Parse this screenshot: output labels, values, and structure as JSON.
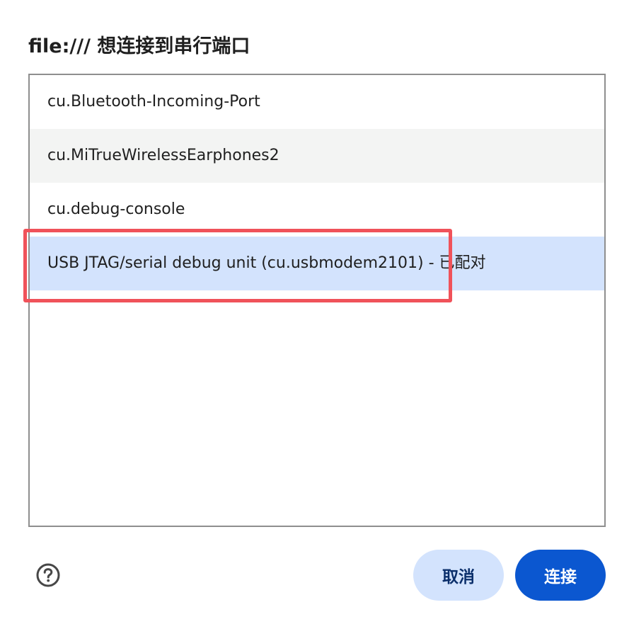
{
  "dialog": {
    "title": "file:/// 想连接到串行端口"
  },
  "ports": [
    {
      "label": "cu.Bluetooth-Incoming-Port",
      "state": "normal"
    },
    {
      "label": "cu.MiTrueWirelessEarphones2",
      "state": "hover"
    },
    {
      "label": "cu.debug-console",
      "state": "normal"
    },
    {
      "label": "USB JTAG/serial debug unit (cu.usbmodem2101) - 已配对",
      "state": "selected"
    }
  ],
  "footer": {
    "help_icon": "help-icon",
    "cancel_label": "取消",
    "connect_label": "连接"
  },
  "colors": {
    "selected_bg": "#d3e3fd",
    "hover_bg": "#f3f4f3",
    "primary": "#0b57d0",
    "annotation": "#f0525a"
  }
}
